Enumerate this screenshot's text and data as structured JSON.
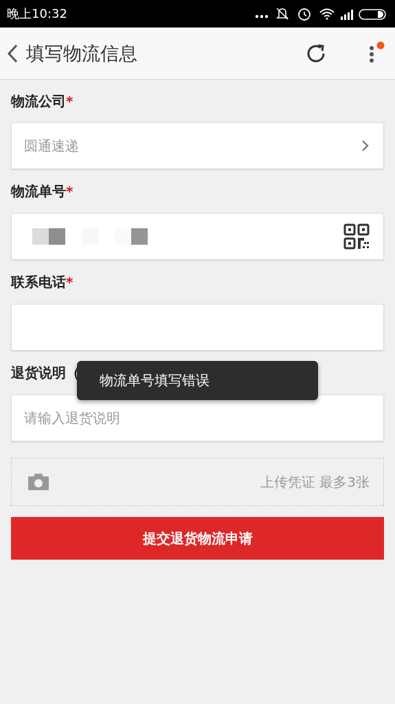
{
  "status_bar": {
    "time": "晚上10:32"
  },
  "header": {
    "title": "填写物流信息",
    "menu_badge": true
  },
  "form": [
    {
      "kind": "select",
      "label": "物流公司",
      "required_mark": "*",
      "value": "圆通速递"
    },
    {
      "kind": "scan",
      "label": "物流单号",
      "required_mark": "*",
      "redacted": true
    },
    {
      "kind": "text",
      "label": "联系电话",
      "required_mark": "*"
    },
    {
      "kind": "text",
      "label": "退货说明（",
      "placeholder": "请输入退货说明"
    }
  ],
  "upload": {
    "text": "上传凭证 最多3张"
  },
  "submit": {
    "label": "提交退货物流申请"
  },
  "toast": {
    "message": "物流单号填写错误"
  }
}
